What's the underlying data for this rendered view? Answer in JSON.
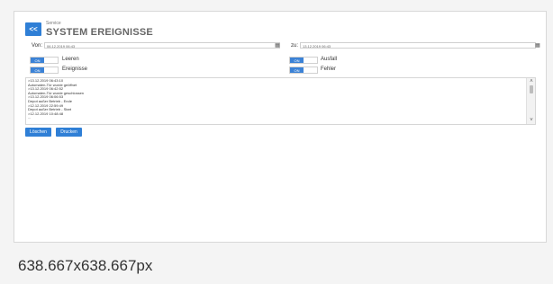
{
  "header": {
    "back_label": "<<",
    "crumb": "Service",
    "title": "SYSTEM EREIGNISSE"
  },
  "filters": {
    "von_label": "Von:",
    "von_value": "06.12.2019 06:43",
    "zu_label": "zu:",
    "zu_value": "13.12.2019 06:43",
    "calendar_icon": "calendar-icon"
  },
  "toggles": [
    {
      "state": "ON",
      "label": "Leeren"
    },
    {
      "state": "ON",
      "label": "Ereignisse"
    },
    {
      "state": "ON",
      "label": "Ausfall"
    },
    {
      "state": "ON",
      "label": "Fehler"
    }
  ],
  "log": {
    "lines": [
      ">13.12.2019 06:43:10",
      " Automaten-Tür wurde geöffnet",
      ">13.12.2019 06:42:52",
      " Automaten-Tür wurde geschlossen",
      ">13.12.2019 06:06:53",
      " Depot außer Betrieb - Ende",
      ">12.12.2019 22:59:49",
      " Depot außer Betrieb - Start",
      ">12.12.2019 10:48:48",
      " ..."
    ]
  },
  "buttons": {
    "clear": "Löschen",
    "print": "Drucken"
  },
  "footer": {
    "dimensions": "638.667x638.667px"
  },
  "colors": {
    "accent": "#2f7fd6",
    "toggle_on": "#3b82d6"
  }
}
